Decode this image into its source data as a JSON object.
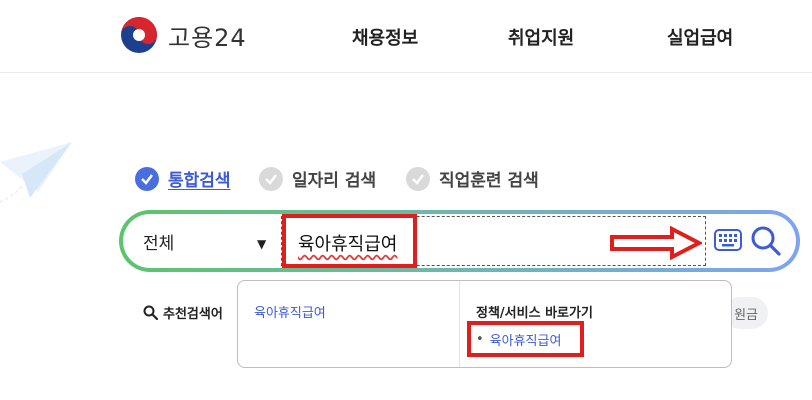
{
  "header": {
    "logo_text": "고용24",
    "nav": [
      "채용정보",
      "취업지원",
      "실업급여"
    ]
  },
  "search": {
    "tabs": [
      {
        "label": "통합검색",
        "selected": true
      },
      {
        "label": "일자리 검색",
        "selected": false
      },
      {
        "label": "직업훈련 검색",
        "selected": false
      }
    ],
    "category": "전체",
    "query": "육아휴직급여",
    "recommended_label": "추천검색어",
    "right_chip_text": "원금"
  },
  "dropdown": {
    "suggestion": "육아휴직급여",
    "policy_title": "정책/서비스 바로가기",
    "policy_link": "육아휴직급여"
  },
  "colors": {
    "accent_blue": "#3d5bd9",
    "gradient_start": "#5cc46a",
    "gradient_end": "#7fa4f0",
    "annotation_red": "#e01e1e"
  }
}
